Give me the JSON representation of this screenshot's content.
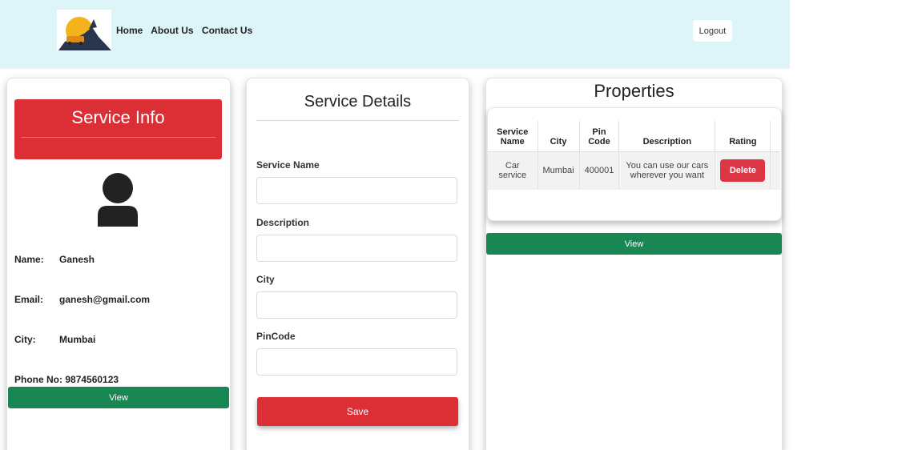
{
  "nav": {
    "links": [
      "Home",
      "About Us",
      "Contact Us"
    ],
    "logout_label": "Logout"
  },
  "service_info": {
    "title": "Service Info",
    "fields": [
      {
        "label": "Name:",
        "value": "Ganesh"
      },
      {
        "label": "Email:",
        "value": "ganesh@gmail.com"
      },
      {
        "label": "City:",
        "value": "Mumbai"
      },
      {
        "label": "Phone No:",
        "value": "9874560123"
      }
    ],
    "view_label": "View"
  },
  "service_details": {
    "title": "Service Details",
    "fields": [
      {
        "label": "Service Name",
        "value": ""
      },
      {
        "label": "Description",
        "value": ""
      },
      {
        "label": "City",
        "value": ""
      },
      {
        "label": "PinCode",
        "value": ""
      }
    ],
    "save_label": "Save"
  },
  "properties": {
    "title": "Properties",
    "columns": [
      "Service Name",
      "City",
      "Pin Code",
      "Description",
      "Rating"
    ],
    "rows": [
      {
        "service_name": "Car service",
        "city": "Mumbai",
        "pin_code": "400001",
        "description": "You can use our cars wherever you want",
        "action_label": "Delete"
      }
    ],
    "view_label": "View"
  },
  "colors": {
    "navbar_bg": "#ddf5f8",
    "primary_red": "#dc2f35",
    "success_green": "#198754",
    "delete_red": "#dc3545"
  }
}
